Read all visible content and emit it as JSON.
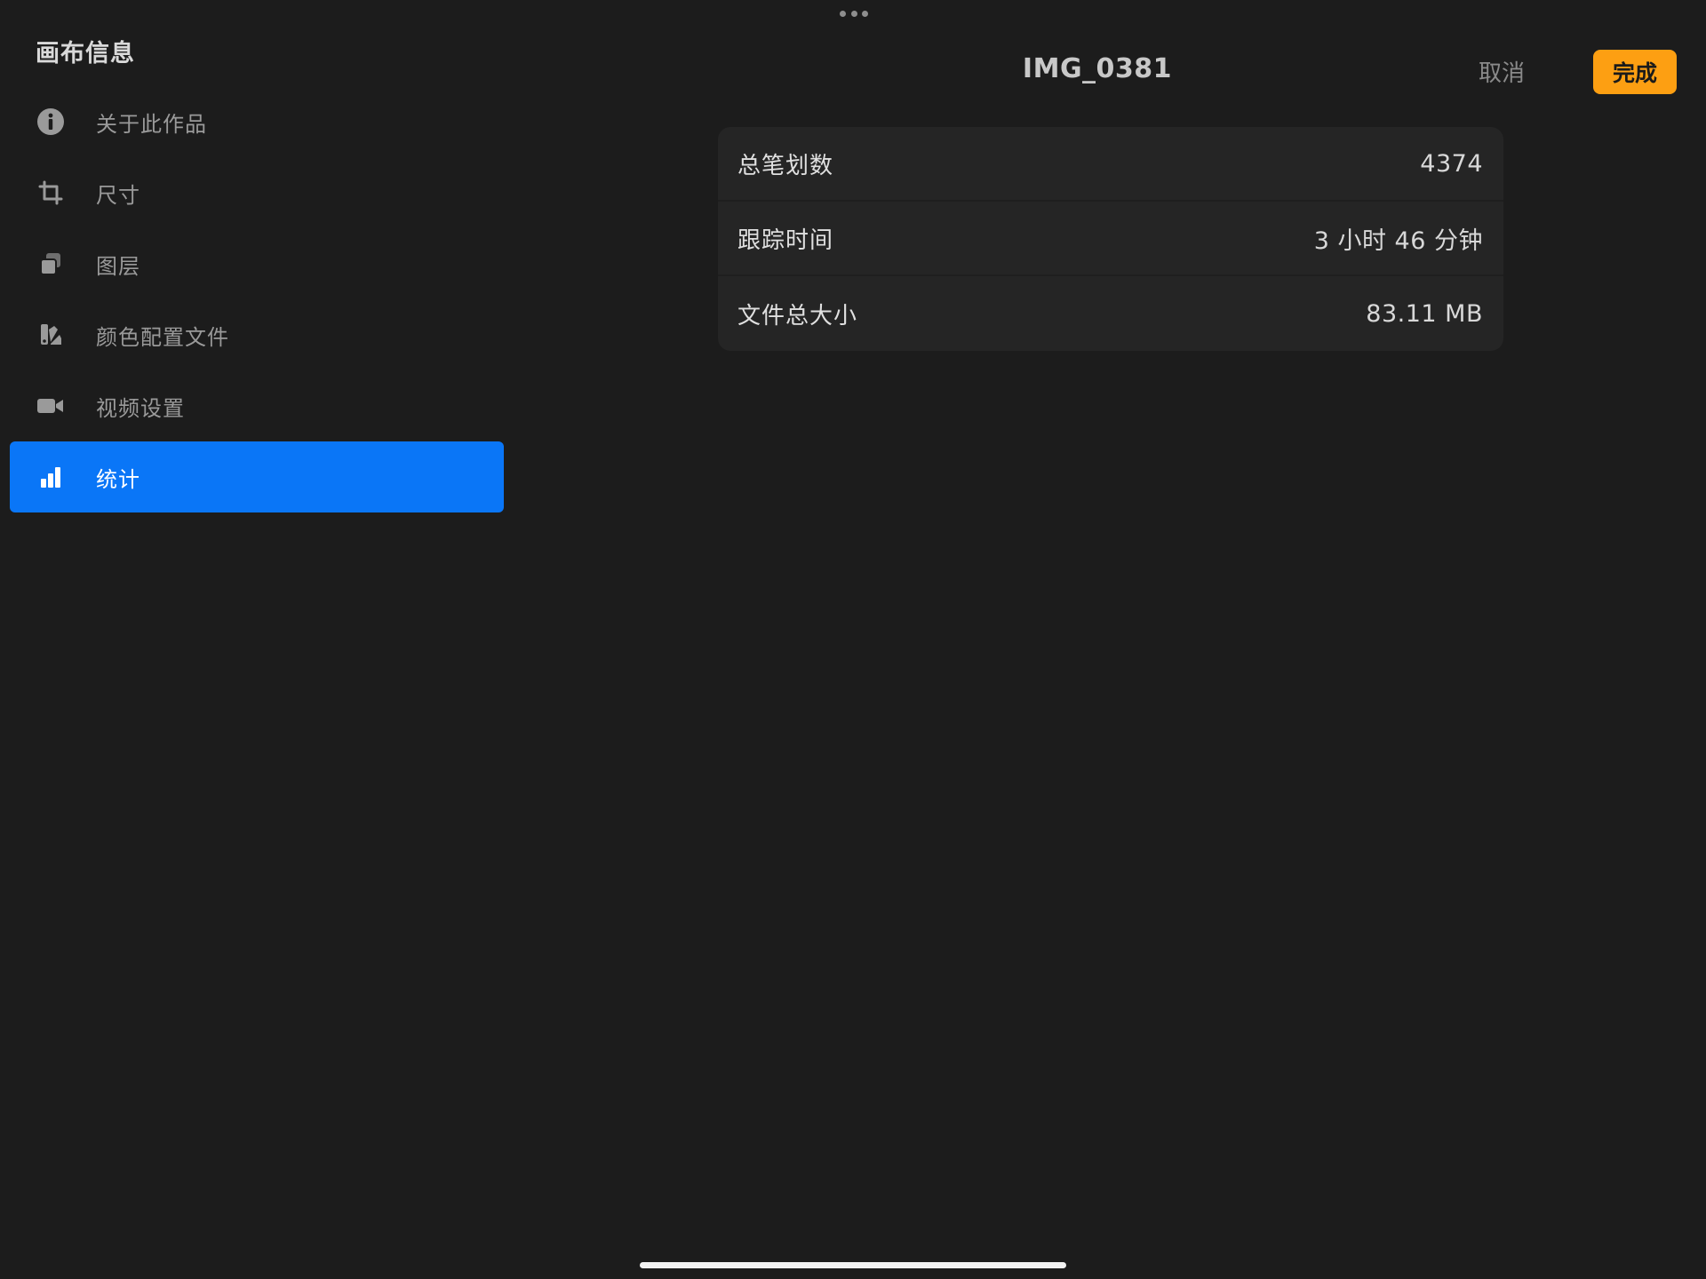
{
  "sidebar": {
    "title": "画布信息",
    "items": [
      {
        "label": "关于此作品",
        "icon": "info-icon",
        "active": false
      },
      {
        "label": "尺寸",
        "icon": "crop-icon",
        "active": false
      },
      {
        "label": "图层",
        "icon": "layers-icon",
        "active": false
      },
      {
        "label": "颜色配置文件",
        "icon": "color-profile-icon",
        "active": false
      },
      {
        "label": "视频设置",
        "icon": "video-camera-icon",
        "active": false
      },
      {
        "label": "统计",
        "icon": "bar-chart-icon",
        "active": true
      }
    ]
  },
  "header": {
    "title": "IMG_0381",
    "cancel_label": "取消",
    "done_label": "完成"
  },
  "stats": {
    "rows": [
      {
        "label": "总笔划数",
        "value": "4374"
      },
      {
        "label": "跟踪时间",
        "value": "3 小时 46 分钟"
      },
      {
        "label": "文件总大小",
        "value": "83.11 MB"
      }
    ]
  },
  "colors": {
    "background": "#1c1c1c",
    "accent_blue": "#0a76f7",
    "done_orange": "#fd9f12",
    "card": "#252525"
  }
}
